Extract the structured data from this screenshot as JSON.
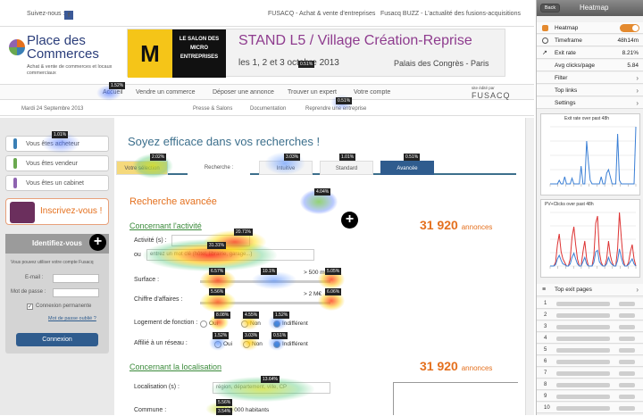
{
  "topbar": {
    "suivez": "Suivez-nous :",
    "fb": "f",
    "fusacq": "FUSACQ - Achat & vente d'entreprises",
    "buzz": "Fusacq BUZZ - L'actualité des fusions-acquisitions"
  },
  "logo": {
    "title1": "Place des",
    "title2": "Commerces",
    "sub": "Achat & vente de commerces et locaux commerciaux"
  },
  "banner": {
    "icon": "M",
    "micro": "LE SALON DES MICRO ENTREPRISES",
    "stand": "STAND L5 / Village Création-Reprise",
    "dates": "les 1, 2 et 3 octobre 2013",
    "palais": "Palais des Congrès - Paris"
  },
  "nav": {
    "items": [
      "Accueil",
      "Vendre un commerce",
      "Déposer une annonce",
      "Trouver un expert",
      "Votre compte"
    ],
    "brand_small": "site édité par",
    "brand": "FUSACQ"
  },
  "subnav": {
    "date": "Mardi 24 Septembre 2013",
    "links": [
      "Presse & Salons",
      "Documentation",
      "Reprendre une entreprise"
    ]
  },
  "left": {
    "roles": [
      "Vous êtes acheteur",
      "Vous êtes vendeur",
      "Vous êtes un cabinet"
    ],
    "role_colors": [
      "#3a7fb5",
      "#6aa84f",
      "#8e63b0"
    ],
    "inscrivez": "Inscrivez-vous !",
    "login": {
      "title": "Identifiez-vous",
      "hint": "Vous pouvez utiliser votre compte Fusacq",
      "email": "E-mail :",
      "password": "Mot de passe :",
      "remember": "Connexion permanente",
      "forgot": "Mot de passe oublié ?",
      "submit": "Connexion"
    }
  },
  "main": {
    "headline": "Soyez efficace dans vos recherches !",
    "tabs": [
      "Votre sélection",
      "Recherche :",
      "Intuitive",
      "Standard",
      "Avancée"
    ],
    "advanced_title": "Recherche avancée",
    "activity": {
      "title": "Concernant l'activité",
      "count": "31 920",
      "count_unit": "annonces",
      "activite_label": "Activité (s) :",
      "ou_label": "ou",
      "activite_placeholder": "entrez un mot clé (hôtel, librairie, garage...)",
      "surface_label": "Surface :",
      "surface_max": "> 500 m²",
      "ca_label": "Chiffre d'affaires :",
      "ca_max": "> 2 M€",
      "logement_label": "Logement de fonction :",
      "affilie_label": "Affilié à un réseau :",
      "opt_oui": "Oui",
      "opt_non": "Non",
      "opt_indiff": "Indifférent"
    },
    "location": {
      "title": "Concernant la localisation",
      "count": "31 920",
      "count_unit": "annonces",
      "loc_label": "Localisation (s) :",
      "loc_placeholder": "région, département, ville, CP",
      "commune_label": "Commune :",
      "commune_value": "> 100 000 habitants"
    }
  },
  "badges": [
    "1.52%",
    "0.51%",
    "0.51%",
    "1.01%",
    "2.02%",
    "3.03%",
    "1.01%",
    "0.51%",
    "4.04%",
    "20.71%",
    "31.31%",
    "6.57%",
    "10.1%",
    "5.05%",
    "5.56%",
    "6.06%",
    "8.08%",
    "4.55%",
    "1.52%",
    "1.52%",
    "3.03%",
    "0.51%",
    "13.64%",
    "5.56%",
    "3.54%"
  ],
  "panel": {
    "back": "Back",
    "title": "Heatmap",
    "rows": [
      {
        "k": "Heatmap",
        "v": ""
      },
      {
        "k": "Timeframe",
        "v": "48h14m"
      },
      {
        "k": "Exit rate",
        "v": "8.21%"
      },
      {
        "k": "Avg clicks/page",
        "v": "5.84"
      },
      {
        "k": "Filter",
        "v": ""
      },
      {
        "k": "Top links",
        "v": ""
      },
      {
        "k": "Settings",
        "v": ""
      }
    ],
    "chart1_title": "Exit rate over past 48h",
    "chart2_title": "PV+Clicks over past 48h",
    "exit_title": "Top exit pages",
    "exit_numbers": [
      "1",
      "2",
      "3",
      "4",
      "5",
      "6",
      "7",
      "8",
      "9",
      "10"
    ],
    "accent": "#e48a2f"
  },
  "chart_data": [
    {
      "type": "line",
      "title": "Exit rate over past 48h",
      "series": [
        {
          "values": [
            0,
            0,
            0,
            0,
            0,
            5,
            0,
            0,
            10,
            0,
            0,
            0,
            8,
            0,
            0,
            0,
            0,
            25,
            0,
            0,
            60,
            30,
            5,
            0,
            0,
            0,
            0,
            0,
            10,
            0,
            0,
            15,
            20,
            10,
            0,
            0,
            0,
            70,
            5,
            0,
            0,
            0,
            0,
            0,
            0,
            0,
            0,
            80
          ]
        }
      ],
      "color": "#3a7fd5"
    },
    {
      "type": "line",
      "title": "PV+Clicks over past 48h",
      "series": [
        {
          "values": [
            0,
            0,
            0,
            5,
            30,
            45,
            20,
            10,
            5,
            0,
            0,
            10,
            40,
            55,
            30,
            10,
            0,
            0,
            20,
            35,
            10,
            0,
            0,
            0,
            15,
            60,
            70,
            20,
            5,
            0,
            0,
            10,
            35,
            15,
            5,
            0,
            0,
            25,
            75,
            40,
            10,
            0,
            0,
            5,
            20,
            30,
            10,
            0
          ],
          "color": "#d33"
        },
        {
          "values": [
            0,
            0,
            0,
            2,
            10,
            15,
            8,
            3,
            2,
            0,
            0,
            3,
            12,
            18,
            10,
            3,
            0,
            0,
            6,
            12,
            3,
            0,
            0,
            0,
            5,
            20,
            22,
            6,
            2,
            0,
            0,
            3,
            12,
            5,
            2,
            0,
            0,
            8,
            24,
            12,
            3,
            0,
            0,
            2,
            6,
            10,
            3,
            0
          ],
          "color": "#3a7fd5"
        }
      ]
    }
  ]
}
